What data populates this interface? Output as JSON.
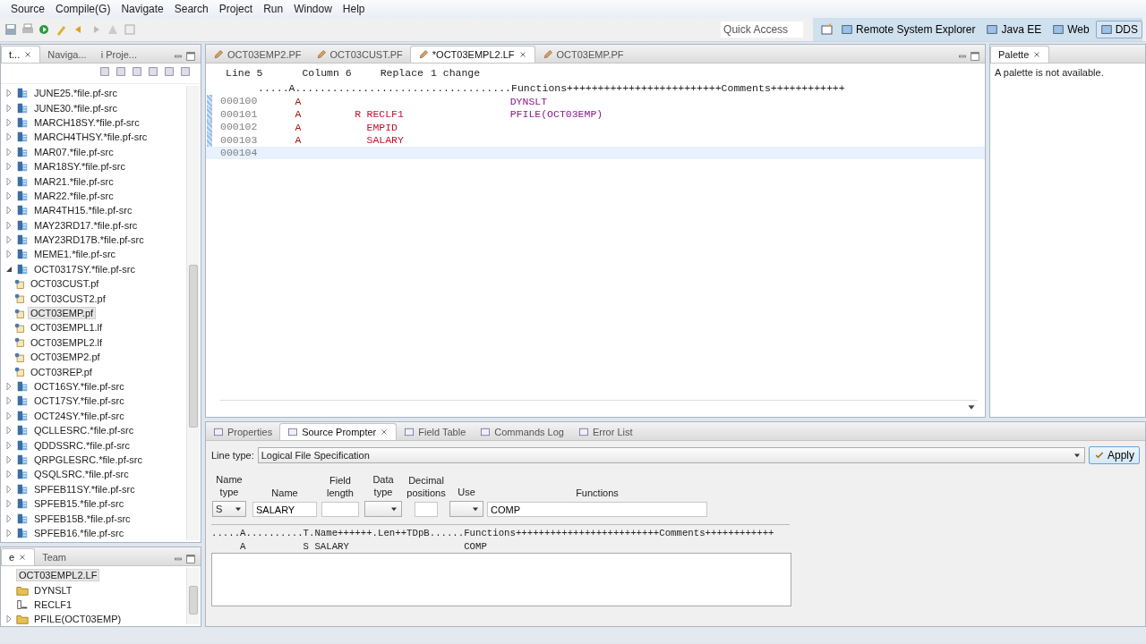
{
  "menu": [
    "Source",
    "Compile(G)",
    "Navigate",
    "Search",
    "Project",
    "Run",
    "Window",
    "Help"
  ],
  "quick_access": {
    "placeholder": "Quick Access"
  },
  "perspectives": [
    {
      "label": "Remote System Explorer",
      "selected": false
    },
    {
      "label": "Java EE",
      "selected": false
    },
    {
      "label": "Web",
      "selected": false
    },
    {
      "label": "DDS",
      "selected": true
    }
  ],
  "left_panel": {
    "tabs": [
      {
        "label": "t...",
        "selected": true
      },
      {
        "label": "Naviga...",
        "selected": false
      },
      {
        "label": "i Proje...",
        "selected": false
      }
    ],
    "tree": [
      {
        "label": "JUNE25.*file.pf-src",
        "kind": "file",
        "expanded": false,
        "selected": false
      },
      {
        "label": "JUNE30.*file.pf-src",
        "kind": "file",
        "expanded": false,
        "selected": false
      },
      {
        "label": "MARCH18SY.*file.pf-src",
        "kind": "file",
        "expanded": false,
        "selected": false
      },
      {
        "label": "MARCH4THSY.*file.pf-src",
        "kind": "file",
        "expanded": false,
        "selected": false
      },
      {
        "label": "MAR07.*file.pf-src",
        "kind": "file",
        "expanded": false,
        "selected": false
      },
      {
        "label": "MAR18SY.*file.pf-src",
        "kind": "file",
        "expanded": false,
        "selected": false
      },
      {
        "label": "MAR21.*file.pf-src",
        "kind": "file",
        "expanded": false,
        "selected": false
      },
      {
        "label": "MAR22.*file.pf-src",
        "kind": "file",
        "expanded": false,
        "selected": false
      },
      {
        "label": "MAR4TH15.*file.pf-src",
        "kind": "file",
        "expanded": false,
        "selected": false
      },
      {
        "label": "MAY23RD17.*file.pf-src",
        "kind": "file",
        "expanded": false,
        "selected": false
      },
      {
        "label": "MAY23RD17B.*file.pf-src",
        "kind": "file",
        "expanded": false,
        "selected": false
      },
      {
        "label": "MEME1.*file.pf-src",
        "kind": "file",
        "expanded": false,
        "selected": false
      },
      {
        "label": "OCT0317SY.*file.pf-src",
        "kind": "file",
        "expanded": true,
        "selected": false,
        "children": [
          {
            "label": "OCT03CUST.pf",
            "kind": "member",
            "selected": false
          },
          {
            "label": "OCT03CUST2.pf",
            "kind": "member",
            "selected": false
          },
          {
            "label": "OCT03EMP.pf",
            "kind": "member",
            "selected": true
          },
          {
            "label": "OCT03EMPL1.lf",
            "kind": "member",
            "selected": false
          },
          {
            "label": "OCT03EMPL2.lf",
            "kind": "member",
            "selected": false
          },
          {
            "label": "OCT03EMP2.pf",
            "kind": "member",
            "selected": false
          },
          {
            "label": "OCT03REP.pf",
            "kind": "member",
            "selected": false
          }
        ]
      },
      {
        "label": "OCT16SY.*file.pf-src",
        "kind": "file",
        "expanded": false,
        "selected": false
      },
      {
        "label": "OCT17SY.*file.pf-src",
        "kind": "file",
        "expanded": false,
        "selected": false
      },
      {
        "label": "OCT24SY.*file.pf-src",
        "kind": "file",
        "expanded": false,
        "selected": false
      },
      {
        "label": "QCLLESRC.*file.pf-src",
        "kind": "file",
        "expanded": false,
        "selected": false
      },
      {
        "label": "QDDSSRC.*file.pf-src",
        "kind": "file",
        "expanded": false,
        "selected": false
      },
      {
        "label": "QRPGLESRC.*file.pf-src",
        "kind": "file",
        "expanded": false,
        "selected": false
      },
      {
        "label": "QSQLSRC.*file.pf-src",
        "kind": "file",
        "expanded": false,
        "selected": false
      },
      {
        "label": "SPFEB11SY.*file.pf-src",
        "kind": "file",
        "expanded": false,
        "selected": false
      },
      {
        "label": "SPFEB15.*file.pf-src",
        "kind": "file",
        "expanded": false,
        "selected": false
      },
      {
        "label": "SPFEB15B.*file.pf-src",
        "kind": "file",
        "expanded": false,
        "selected": false
      },
      {
        "label": "SPFEB16.*file.pf-src",
        "kind": "file",
        "expanded": false,
        "selected": false
      }
    ]
  },
  "outline_panel": {
    "tabs": [
      {
        "label": "e",
        "selected": true
      },
      {
        "label": "Team",
        "selected": false
      }
    ],
    "tree": [
      {
        "label": "OCT03EMPL2.LF",
        "kind": "root",
        "selected": true
      },
      {
        "label": "DYNSLT",
        "kind": "keyword",
        "selected": false
      },
      {
        "label": "RECLF1",
        "kind": "record",
        "selected": false
      },
      {
        "label": "PFILE(OCT03EMP)",
        "kind": "keyword",
        "expanded": false,
        "selected": false
      }
    ]
  },
  "editor": {
    "tabs": [
      {
        "label": "OCT03EMP2.PF",
        "selected": false
      },
      {
        "label": "OCT03CUST.PF",
        "selected": false
      },
      {
        "label": "*OCT03EMPL2.LF",
        "selected": true
      },
      {
        "label": "OCT03EMP.PF",
        "selected": false
      }
    ],
    "status": [
      "Line 5",
      "Column 6",
      "Replace",
      "1 change"
    ],
    "ruler": ".....A...................................Functions+++++++++++++++++++++++++Comments++++++++++++",
    "lines": [
      {
        "number": "000100",
        "spec": "A",
        "functions": "DYNSLT",
        "changed": true,
        "current": false
      },
      {
        "number": "000101",
        "spec": "A",
        "type": "R",
        "name": "RECLF1",
        "functions": "PFILE(OCT03EMP)",
        "changed": true,
        "current": false
      },
      {
        "number": "000102",
        "spec": "A",
        "name": "EMPID",
        "changed": true,
        "current": false
      },
      {
        "number": "000103",
        "spec": "A",
        "name": "SALARY",
        "changed": true,
        "current": false
      },
      {
        "number": "000104",
        "changed": false,
        "current": true
      }
    ]
  },
  "palette": {
    "title": "Palette",
    "message": "A palette is not available."
  },
  "bottom_panel": {
    "tabs": [
      {
        "label": "Properties",
        "selected": false
      },
      {
        "label": "Source Prompter",
        "selected": true
      },
      {
        "label": "Field Table",
        "selected": false
      },
      {
        "label": "Commands Log",
        "selected": false
      },
      {
        "label": "Error List",
        "selected": false
      }
    ],
    "line_type": {
      "label": "Line type:",
      "value": "Logical File Specification"
    },
    "apply": "Apply",
    "fields": [
      {
        "label": "Name type",
        "kind": "dropdown",
        "value": "S"
      },
      {
        "label": "Name",
        "kind": "text",
        "value": "SALARY"
      },
      {
        "label": "Field length",
        "kind": "text"
      },
      {
        "label": "Data type",
        "kind": "dropdown"
      },
      {
        "label": "Decimal positions",
        "kind": "text"
      },
      {
        "label": "Use",
        "kind": "dropdown"
      },
      {
        "label": "Functions",
        "kind": "text",
        "value": "COMP"
      }
    ],
    "preview_ruler": ".....A..........T.Name++++++.Len++TDpB......Functions+++++++++++++++++++++++++Comments++++++++++++",
    "preview_line": {
      "spec": "A",
      "type": "S",
      "name": "SALARY",
      "functions": "COMP"
    }
  }
}
